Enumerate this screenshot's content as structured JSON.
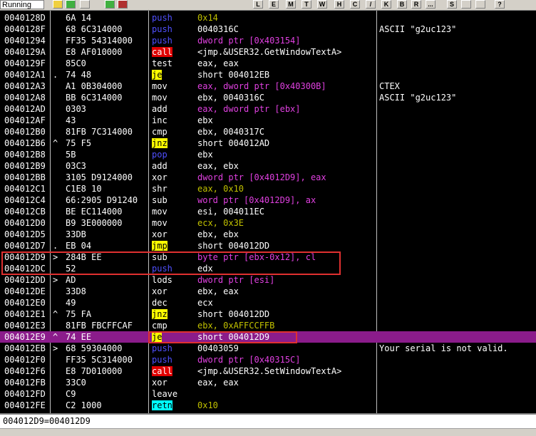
{
  "toolbar": {
    "status": "Running",
    "buttons": [
      {
        "label": "",
        "icon": "open-icon"
      },
      {
        "label": "",
        "icon": "restart-icon"
      },
      {
        "label": "",
        "icon": "close-icon"
      },
      {
        "label": "",
        "icon": "run-icon"
      },
      {
        "label": "",
        "icon": "pause-icon"
      },
      {
        "label": "L",
        "icon": "log-window-icon"
      },
      {
        "label": "E",
        "icon": "executable-modules-icon"
      },
      {
        "label": "M",
        "icon": "memory-map-icon"
      },
      {
        "label": "T",
        "icon": "threads-icon"
      },
      {
        "label": "W",
        "icon": "windows-icon"
      },
      {
        "label": "H",
        "icon": "handles-icon"
      },
      {
        "label": "C",
        "icon": "cpu-icon"
      },
      {
        "label": "/",
        "icon": "patches-icon"
      },
      {
        "label": "K",
        "icon": "call-stack-icon"
      },
      {
        "label": "B",
        "icon": "breakpoints-icon"
      },
      {
        "label": "R",
        "icon": "references-icon"
      },
      {
        "label": "...",
        "icon": "run-trace-icon"
      },
      {
        "label": "S",
        "icon": "source-icon"
      },
      {
        "label": "",
        "icon": "list-icon"
      },
      {
        "label": "",
        "icon": "grid-icon"
      },
      {
        "label": "?",
        "icon": "help-icon"
      }
    ]
  },
  "rows": [
    {
      "addr": "0040128D",
      "mark": "",
      "hex": "6A 14",
      "op": "push",
      "op_class": "push",
      "args": "0x14",
      "arg_class": "imm",
      "comment": ""
    },
    {
      "addr": "0040128F",
      "mark": "",
      "hex": "68 6C314000",
      "op": "push",
      "op_class": "push",
      "args": "0040316C",
      "arg_class": "plain",
      "comment": "ASCII \"g2uc123\""
    },
    {
      "addr": "00401294",
      "mark": "",
      "hex": "FF35 54314000",
      "op": "push",
      "op_class": "push",
      "args": "dword ptr [0x403154]",
      "arg_class": "mem",
      "comment": ""
    },
    {
      "addr": "0040129A",
      "mark": "",
      "hex": "E8 AF010000",
      "op": "call",
      "op_class": "call",
      "args": "<jmp.&USER32.GetWindowTextA>",
      "arg_class": "plain",
      "comment": ""
    },
    {
      "addr": "0040129F",
      "mark": "",
      "hex": "85C0",
      "op": "test",
      "op_class": "plain",
      "args": "eax, eax",
      "arg_class": "plain",
      "comment": ""
    },
    {
      "addr": "004012A1",
      "mark": ".",
      "hex": "74 48",
      "op": "je",
      "op_class": "jcc",
      "args": "short 004012EB",
      "arg_class": "plain",
      "comment": ""
    },
    {
      "addr": "004012A3",
      "mark": "",
      "hex": "A1 0B304000",
      "op": "mov",
      "op_class": "plain",
      "args": "eax, dword ptr [0x40300B]",
      "arg_class": "mem",
      "comment": "CTEX"
    },
    {
      "addr": "004012A8",
      "mark": "",
      "hex": "BB 6C314000",
      "op": "mov",
      "op_class": "plain",
      "args": "ebx, 0040316C",
      "arg_class": "plain",
      "comment": "ASCII \"g2uc123\""
    },
    {
      "addr": "004012AD",
      "mark": "",
      "hex": "0303",
      "op": "add",
      "op_class": "plain",
      "args": "eax, dword ptr [ebx]",
      "arg_class": "mem",
      "comment": ""
    },
    {
      "addr": "004012AF",
      "mark": "",
      "hex": "43",
      "op": "inc",
      "op_class": "plain",
      "args": "ebx",
      "arg_class": "plain",
      "comment": ""
    },
    {
      "addr": "004012B0",
      "mark": "",
      "hex": "81FB 7C314000",
      "op": "cmp",
      "op_class": "plain",
      "args": "ebx, 0040317C",
      "arg_class": "plain",
      "comment": ""
    },
    {
      "addr": "004012B6",
      "mark": "^",
      "hex": "75 F5",
      "op": "jnz",
      "op_class": "jcc",
      "args": "short 004012AD",
      "arg_class": "plain",
      "comment": ""
    },
    {
      "addr": "004012B8",
      "mark": "",
      "hex": "5B",
      "op": "pop",
      "op_class": "pop",
      "args": "ebx",
      "arg_class": "plain",
      "comment": ""
    },
    {
      "addr": "004012B9",
      "mark": "",
      "hex": "03C3",
      "op": "add",
      "op_class": "plain",
      "args": "eax, ebx",
      "arg_class": "plain",
      "comment": ""
    },
    {
      "addr": "004012BB",
      "mark": "",
      "hex": "3105 D9124000",
      "op": "xor",
      "op_class": "plain",
      "args": "dword ptr [0x4012D9], eax",
      "arg_class": "mem",
      "comment": ""
    },
    {
      "addr": "004012C1",
      "mark": "",
      "hex": "C1E8 10",
      "op": "shr",
      "op_class": "plain",
      "args": "eax, 0x10",
      "arg_class": "imm",
      "comment": ""
    },
    {
      "addr": "004012C4",
      "mark": "",
      "hex": "66:2905 D91240",
      "op": "sub",
      "op_class": "plain",
      "args": "word ptr [0x4012D9], ax",
      "arg_class": "mem",
      "comment": ""
    },
    {
      "addr": "004012CB",
      "mark": "",
      "hex": "BE EC114000",
      "op": "mov",
      "op_class": "plain",
      "args": "esi, 004011EC",
      "arg_class": "plain",
      "comment": ""
    },
    {
      "addr": "004012D0",
      "mark": "",
      "hex": "B9 3E000000",
      "op": "mov",
      "op_class": "plain",
      "args": "ecx, 0x3E",
      "arg_class": "imm",
      "comment": ""
    },
    {
      "addr": "004012D5",
      "mark": "",
      "hex": "33DB",
      "op": "xor",
      "op_class": "plain",
      "args": "ebx, ebx",
      "arg_class": "plain",
      "comment": ""
    },
    {
      "addr": "004012D7",
      "mark": ".",
      "hex": "EB 04",
      "op": "jmp",
      "op_class": "jcc",
      "args": "short 004012DD",
      "arg_class": "plain",
      "comment": ""
    },
    {
      "addr": "004012D9",
      "mark": ">",
      "hex": "284B EE",
      "op": "sub",
      "op_class": "plain",
      "args": "byte ptr [ebx-0x12], cl",
      "arg_class": "mem",
      "comment": ""
    },
    {
      "addr": "004012DC",
      "mark": "",
      "hex": "52",
      "op": "push",
      "op_class": "push",
      "args": "edx",
      "arg_class": "plain",
      "comment": ""
    },
    {
      "addr": "004012DD",
      "mark": ">",
      "hex": "AD",
      "op": "lods",
      "op_class": "plain",
      "args": "dword ptr [esi]",
      "arg_class": "mem",
      "comment": ""
    },
    {
      "addr": "004012DE",
      "mark": "",
      "hex": "33D8",
      "op": "xor",
      "op_class": "plain",
      "args": "ebx, eax",
      "arg_class": "plain",
      "comment": ""
    },
    {
      "addr": "004012E0",
      "mark": "",
      "hex": "49",
      "op": "dec",
      "op_class": "plain",
      "args": "ecx",
      "arg_class": "plain",
      "comment": ""
    },
    {
      "addr": "004012E1",
      "mark": "^",
      "hex": "75 FA",
      "op": "jnz",
      "op_class": "jcc",
      "args": "short 004012DD",
      "arg_class": "plain",
      "comment": ""
    },
    {
      "addr": "004012E3",
      "mark": "",
      "hex": "81FB FBCFFCAF",
      "op": "cmp",
      "op_class": "plain",
      "args": "ebx, 0xAFFCCFFB",
      "arg_class": "imm",
      "comment": ""
    },
    {
      "addr": "004012E9",
      "mark": "^",
      "hex": "74 EE",
      "op": "je",
      "op_class": "jcc",
      "args": "short 004012D9",
      "arg_class": "plain",
      "comment": "",
      "selected": true
    },
    {
      "addr": "004012EB",
      "mark": ">",
      "hex": "68 59304000",
      "op": "push",
      "op_class": "push",
      "args": "00403059",
      "arg_class": "plain",
      "comment": "Your serial is not valid."
    },
    {
      "addr": "004012F0",
      "mark": "",
      "hex": "FF35 5C314000",
      "op": "push",
      "op_class": "push",
      "args": "dword ptr [0x40315C]",
      "arg_class": "mem",
      "comment": ""
    },
    {
      "addr": "004012F6",
      "mark": "",
      "hex": "E8 7D010000",
      "op": "call",
      "op_class": "call",
      "args": "<jmp.&USER32.SetWindowTextA>",
      "arg_class": "plain",
      "comment": ""
    },
    {
      "addr": "004012FB",
      "mark": "",
      "hex": "33C0",
      "op": "xor",
      "op_class": "plain",
      "args": "eax, eax",
      "arg_class": "plain",
      "comment": ""
    },
    {
      "addr": "004012FD",
      "mark": "",
      "hex": "C9",
      "op": "leave",
      "op_class": "plain",
      "args": "",
      "arg_class": "plain",
      "comment": ""
    },
    {
      "addr": "004012FE",
      "mark": "",
      "hex": "C2 1000",
      "op": "retn",
      "op_class": "ret",
      "args": "0x10",
      "arg_class": "imm",
      "comment": ""
    }
  ],
  "info": {
    "text": "004012D9=004012D9"
  }
}
